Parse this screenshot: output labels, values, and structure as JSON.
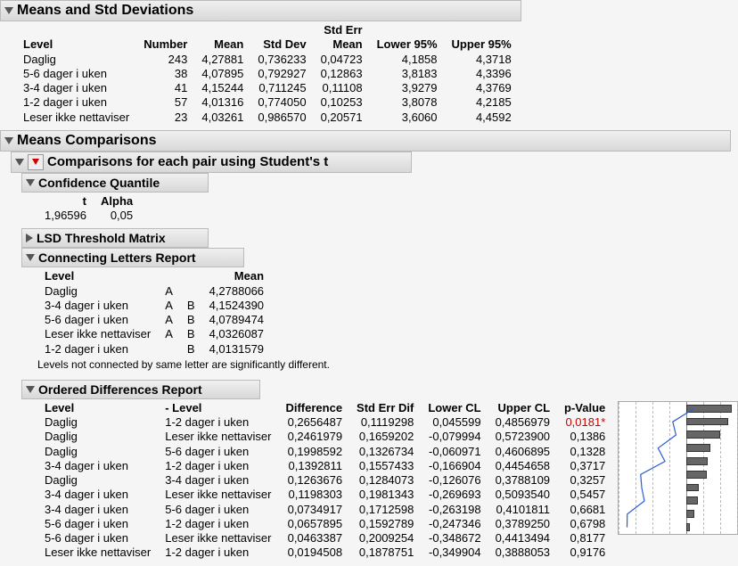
{
  "sections": {
    "means_std": "Means and Std Deviations",
    "means_comp": "Means Comparisons",
    "pairs_comp": "Comparisons for each pair using Student's t",
    "conf_quant": "Confidence Quantile",
    "lsd": "LSD Threshold Matrix",
    "letters": "Connecting Letters Report",
    "ordered": "Ordered Differences Report"
  },
  "means_std": {
    "headers": {
      "level": "Level",
      "number": "Number",
      "mean": "Mean",
      "stddev": "Std Dev",
      "stderr1": "Std Err",
      "stderr2": "Mean",
      "lower": "Lower 95%",
      "upper": "Upper 95%"
    },
    "rows": [
      {
        "level": "Daglig",
        "number": "243",
        "mean": "4,27881",
        "stddev": "0,736233",
        "stderr": "0,04723",
        "lower": "4,1858",
        "upper": "4,3718"
      },
      {
        "level": "5-6 dager i uken",
        "number": "38",
        "mean": "4,07895",
        "stddev": "0,792927",
        "stderr": "0,12863",
        "lower": "3,8183",
        "upper": "4,3396"
      },
      {
        "level": "3-4 dager i uken",
        "number": "41",
        "mean": "4,15244",
        "stddev": "0,711245",
        "stderr": "0,11108",
        "lower": "3,9279",
        "upper": "4,3769"
      },
      {
        "level": "1-2 dager i uken",
        "number": "57",
        "mean": "4,01316",
        "stddev": "0,774050",
        "stderr": "0,10253",
        "lower": "3,8078",
        "upper": "4,2185"
      },
      {
        "level": "Leser ikke nettaviser",
        "number": "23",
        "mean": "4,03261",
        "stddev": "0,986570",
        "stderr": "0,20571",
        "lower": "3,6060",
        "upper": "4,4592"
      }
    ]
  },
  "conf_quant": {
    "headers": {
      "t": "t",
      "alpha": "Alpha"
    },
    "t": "1,96596",
    "alpha": "0,05"
  },
  "letters": {
    "headers": {
      "level": "Level",
      "mean": "Mean"
    },
    "rows": [
      {
        "level": "Daglig",
        "a": "A",
        "b": "",
        "mean": "4,2788066"
      },
      {
        "level": "3-4 dager i uken",
        "a": "A",
        "b": "B",
        "mean": "4,1524390"
      },
      {
        "level": "5-6 dager i uken",
        "a": "A",
        "b": "B",
        "mean": "4,0789474"
      },
      {
        "level": "Leser ikke nettaviser",
        "a": "A",
        "b": "B",
        "mean": "4,0326087"
      },
      {
        "level": "1-2 dager i uken",
        "a": "",
        "b": "B",
        "mean": "4,0131579"
      }
    ],
    "note": "Levels not connected by same letter are significantly different."
  },
  "ordered": {
    "headers": {
      "level": "Level",
      "minuslevel": "- Level",
      "diff": "Difference",
      "sed": "Std Err Dif",
      "lcl": "Lower CL",
      "ucl": "Upper CL",
      "pval": "p-Value"
    },
    "rows": [
      {
        "level": "Daglig",
        "minuslevel": "1-2 dager i uken",
        "diff": "0,2656487",
        "sed": "0,1119298",
        "lcl": "0,045599",
        "ucl": "0,4856979",
        "pval": "0,0181*",
        "sig": true
      },
      {
        "level": "Daglig",
        "minuslevel": "Leser ikke nettaviser",
        "diff": "0,2461979",
        "sed": "0,1659202",
        "lcl": "-0,079994",
        "ucl": "0,5723900",
        "pval": "0,1386",
        "sig": false
      },
      {
        "level": "Daglig",
        "minuslevel": "5-6 dager i uken",
        "diff": "0,1998592",
        "sed": "0,1326734",
        "lcl": "-0,060971",
        "ucl": "0,4606895",
        "pval": "0,1328",
        "sig": false
      },
      {
        "level": "3-4 dager i uken",
        "minuslevel": "1-2 dager i uken",
        "diff": "0,1392811",
        "sed": "0,1557433",
        "lcl": "-0,166904",
        "ucl": "0,4454658",
        "pval": "0,3717",
        "sig": false
      },
      {
        "level": "Daglig",
        "minuslevel": "3-4 dager i uken",
        "diff": "0,1263676",
        "sed": "0,1284073",
        "lcl": "-0,126076",
        "ucl": "0,3788109",
        "pval": "0,3257",
        "sig": false
      },
      {
        "level": "3-4 dager i uken",
        "minuslevel": "Leser ikke nettaviser",
        "diff": "0,1198303",
        "sed": "0,1981343",
        "lcl": "-0,269693",
        "ucl": "0,5093540",
        "pval": "0,5457",
        "sig": false
      },
      {
        "level": "3-4 dager i uken",
        "minuslevel": "5-6 dager i uken",
        "diff": "0,0734917",
        "sed": "0,1712598",
        "lcl": "-0,263198",
        "ucl": "0,4101811",
        "pval": "0,6681",
        "sig": false
      },
      {
        "level": "5-6 dager i uken",
        "minuslevel": "1-2 dager i uken",
        "diff": "0,0657895",
        "sed": "0,1592789",
        "lcl": "-0,247346",
        "ucl": "0,3789250",
        "pval": "0,6798",
        "sig": false
      },
      {
        "level": "5-6 dager i uken",
        "minuslevel": "Leser ikke nettaviser",
        "diff": "0,0463387",
        "sed": "0,2009254",
        "lcl": "-0,348672",
        "ucl": "0,4413494",
        "pval": "0,8177",
        "sig": false
      },
      {
        "level": "Leser ikke nettaviser",
        "minuslevel": "1-2 dager i uken",
        "diff": "0,0194508",
        "sed": "0,1878751",
        "lcl": "-0,349904",
        "ucl": "0,3888053",
        "pval": "0,9176",
        "sig": false
      }
    ]
  },
  "chart_data": {
    "type": "bar",
    "title": "",
    "xlabel": "",
    "ylabel": "",
    "xlim": [
      -0.4,
      0.6
    ],
    "categories": [
      "Daglig - 1-2 dager i uken",
      "Daglig - Leser ikke nettaviser",
      "Daglig - 5-6 dager i uken",
      "3-4 dager i uken - 1-2 dager i uken",
      "Daglig - 3-4 dager i uken",
      "3-4 dager i uken - Leser ikke nettaviser",
      "3-4 dager i uken - 5-6 dager i uken",
      "5-6 dager i uken - 1-2 dager i uken",
      "5-6 dager i uken - Leser ikke nettaviser",
      "Leser ikke nettaviser - 1-2 dager i uken"
    ],
    "series": [
      {
        "name": "Difference",
        "values": [
          0.2656,
          0.2462,
          0.1999,
          0.1393,
          0.1264,
          0.1198,
          0.0735,
          0.0658,
          0.0463,
          0.0195
        ]
      },
      {
        "name": "Lower CL",
        "values": [
          0.0456,
          -0.08,
          -0.061,
          -0.1669,
          -0.1261,
          -0.2697,
          -0.2632,
          -0.2473,
          -0.3487,
          -0.3499
        ]
      },
      {
        "name": "Upper CL",
        "values": [
          0.4857,
          0.5724,
          0.4607,
          0.4455,
          0.3788,
          0.5094,
          0.4102,
          0.3789,
          0.4413,
          0.3888
        ]
      }
    ]
  }
}
